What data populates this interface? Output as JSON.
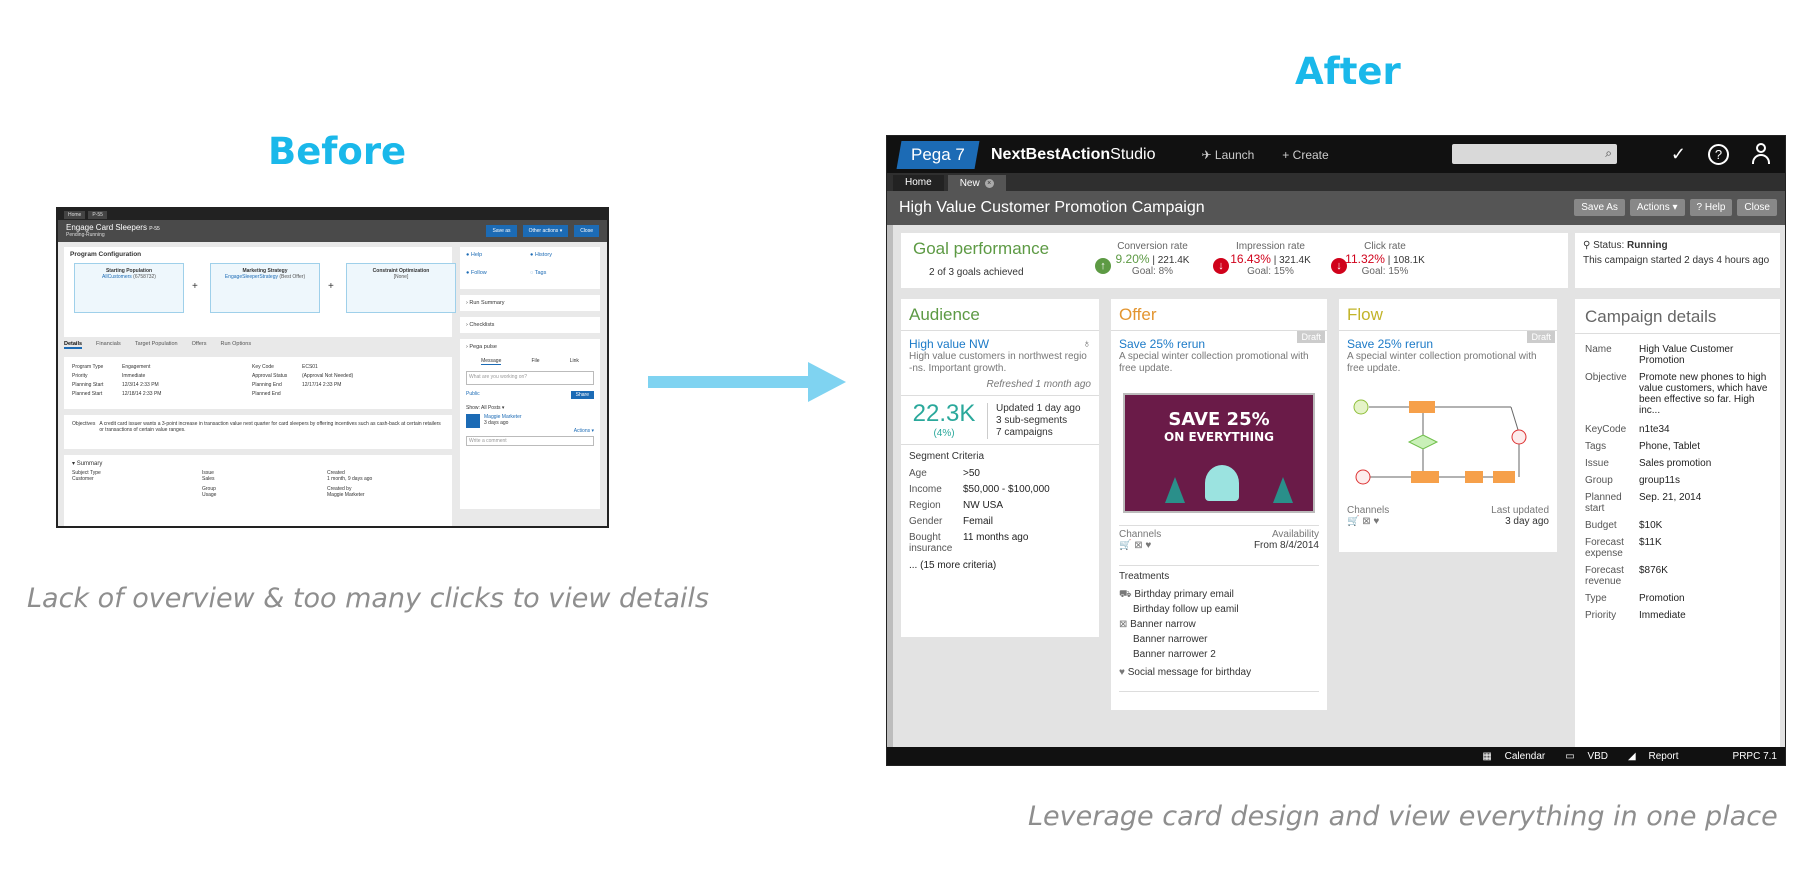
{
  "headings": {
    "before": "Before",
    "after": "After"
  },
  "captions": {
    "before": "Lack of overview & too many clicks to view details",
    "after": "Leverage card design and view everything in one place"
  },
  "before": {
    "tabs": [
      "Home",
      "P-55"
    ],
    "title": "Engage Card Sleepers",
    "title_id": "P-55",
    "status": "Pending-Running",
    "buttons": [
      "Save as",
      "Other actions ▾",
      "Close"
    ],
    "program_config": "Program Configuration",
    "boxes": [
      {
        "title": "Starting Population",
        "link": "AllCustomers",
        "extra": "(6758732)"
      },
      {
        "title": "Marketing Strategy",
        "link": "EngageSleeperStrategy",
        "extra": "(Best Offer)"
      },
      {
        "title": "Constraint Optimization",
        "link": "[None]",
        "extra": ""
      }
    ],
    "tabs2": [
      "Details",
      "Financials",
      "Target Population",
      "Offers",
      "Run Options"
    ],
    "details": [
      [
        "Program Type",
        "Engagement",
        "Key Code",
        "ECS01"
      ],
      [
        "Priority",
        "Immediate",
        "Approval Status",
        "(Approval Not Needed)"
      ],
      [
        "Planning Start",
        "12/3/14 2:33 PM",
        "Planning End",
        "12/17/14 2:33 PM"
      ],
      [
        "Planned Start",
        "12/18/14 2:33 PM",
        "Planned End",
        ""
      ]
    ],
    "objectives_label": "Objectives",
    "objectives_text": "A credit card issuer wants a 3-point increase in transaction value next quarter for card sleepers by offering incentives such as cash-back at certain retailers or transactions of certain value ranges.",
    "summary": "Summary",
    "summary_rows": [
      "Subject Type",
      "Customer",
      "Issue",
      "Sales",
      "Created",
      "1 month, 9 days ago",
      "Group",
      "Usage",
      "Created by",
      "Maggie Marketer"
    ],
    "side": {
      "links": [
        "Help",
        "History",
        "Follow",
        "Tags"
      ],
      "run_summary": "Run Summary",
      "checklists": "Checklists",
      "pulse": "Pega pulse",
      "pulse_tabs": [
        "Message",
        "File",
        "Link"
      ],
      "pulse_placeholder": "What are you working on?",
      "public": "Public",
      "share": "Share",
      "show": "Show: All Posts ▾",
      "author": "Maggie Marketer",
      "age": "3 days ago",
      "actions": "Actions ▾",
      "comment_placeholder": "Write a comment"
    }
  },
  "after": {
    "logo": "Pega 7",
    "brand_bold": "NextBestAction",
    "brand_light": "Studio",
    "nav": [
      "Launch",
      "Create"
    ],
    "tabs": [
      "Home",
      "New"
    ],
    "page_title": "High Value Customer Promotion Campaign",
    "title_buttons": [
      "Save As",
      "Actions ▾",
      "? Help",
      "Close"
    ],
    "goal": {
      "title": "Goal performance",
      "achieved": "2 of 3 goals achieved",
      "metrics": [
        {
          "label": "Conversion rate",
          "value": "9.20%",
          "count": "221.4K",
          "goal": "Goal: 8%",
          "direction": "up",
          "color": "#5d9a44"
        },
        {
          "label": "Impression rate",
          "value": "16.43%",
          "count": "321.4K",
          "goal": "Goal: 15%",
          "direction": "down",
          "color": "#d0021b"
        },
        {
          "label": "Click rate",
          "value": "11.32%",
          "count": "108.1K",
          "goal": "Goal: 15%",
          "direction": "down",
          "color": "#d0021b"
        }
      ]
    },
    "status": {
      "label": "Status:",
      "value": "Running",
      "text": "This campaign started 2 days 4 hours ago"
    },
    "audience": {
      "title": "Audience",
      "name": "High value NW",
      "desc": "High value customers in northwest regio -ns. Important growth.",
      "refreshed": "Refreshed 1 month ago",
      "count": "22.3K",
      "pct": "(4%)",
      "updated": "Updated 1 day ago",
      "subsegments": "3 sub-segments",
      "campaigns": "7 campaigns",
      "criteria_title": "Segment Criteria",
      "criteria": [
        {
          "k": "Age",
          "v": ">50"
        },
        {
          "k": "Income",
          "v": "$50,000 - $100,000"
        },
        {
          "k": "Region",
          "v": "NW USA"
        },
        {
          "k": "Gender",
          "v": "Femail"
        },
        {
          "k": "Bought insurance",
          "v": "11 months ago"
        }
      ],
      "more": "... (15 more criteria)"
    },
    "offer": {
      "title": "Offer",
      "draft": "Draft",
      "name": "Save 25% rerun",
      "desc": "A special winter collection promotional with free update.",
      "promo_big": "SAVE 25%",
      "promo_line2": "ON EVERYTHING",
      "channels_label": "Channels",
      "availability_label": "Availability",
      "availability_value": "From 8/4/2014",
      "treatments_title": "Treatments",
      "treatments": [
        {
          "text": "Birthday primary email",
          "icon": "cart-icon"
        },
        {
          "text": "Birthday follow up eamil",
          "icon": ""
        },
        {
          "text": "Banner narrow",
          "icon": "banner-icon"
        },
        {
          "text": "Banner narrower",
          "icon": ""
        },
        {
          "text": "Banner narrower 2",
          "icon": ""
        },
        {
          "text": "Social message for birthday",
          "icon": "twitter-icon"
        }
      ]
    },
    "flow": {
      "title": "Flow",
      "draft": "Draft",
      "name": "Save 25% rerun",
      "desc": "A special winter collection promotional with free update.",
      "channels_label": "Channels",
      "last_updated_label": "Last updated",
      "last_updated_value": "3 day ago"
    },
    "details": {
      "title": "Campaign details",
      "rows": [
        {
          "k": "Name",
          "v": "High Value Customer Promotion"
        },
        {
          "k": "Objective",
          "v": "Promote new phones to high value customers, which have been effective so far. High inc..."
        },
        {
          "k": "KeyCode",
          "v": "n1te34"
        },
        {
          "k": "Tags",
          "v": "Phone, Tablet"
        },
        {
          "k": "Issue",
          "v": "Sales promotion"
        },
        {
          "k": "Group",
          "v": "group11s"
        },
        {
          "k": "Planned start",
          "v": "Sep. 21, 2014"
        },
        {
          "k": "Budget",
          "v": "$10K"
        },
        {
          "k": "Forecast expense",
          "v": "$11K"
        },
        {
          "k": "Forecast revenue",
          "v": "$876K"
        },
        {
          "k": "Type",
          "v": "Promotion"
        },
        {
          "k": "Priority",
          "v": "Immediate"
        }
      ]
    },
    "bottom": [
      "Calendar",
      "VBD",
      "Report",
      "PRPC 7.1"
    ]
  }
}
